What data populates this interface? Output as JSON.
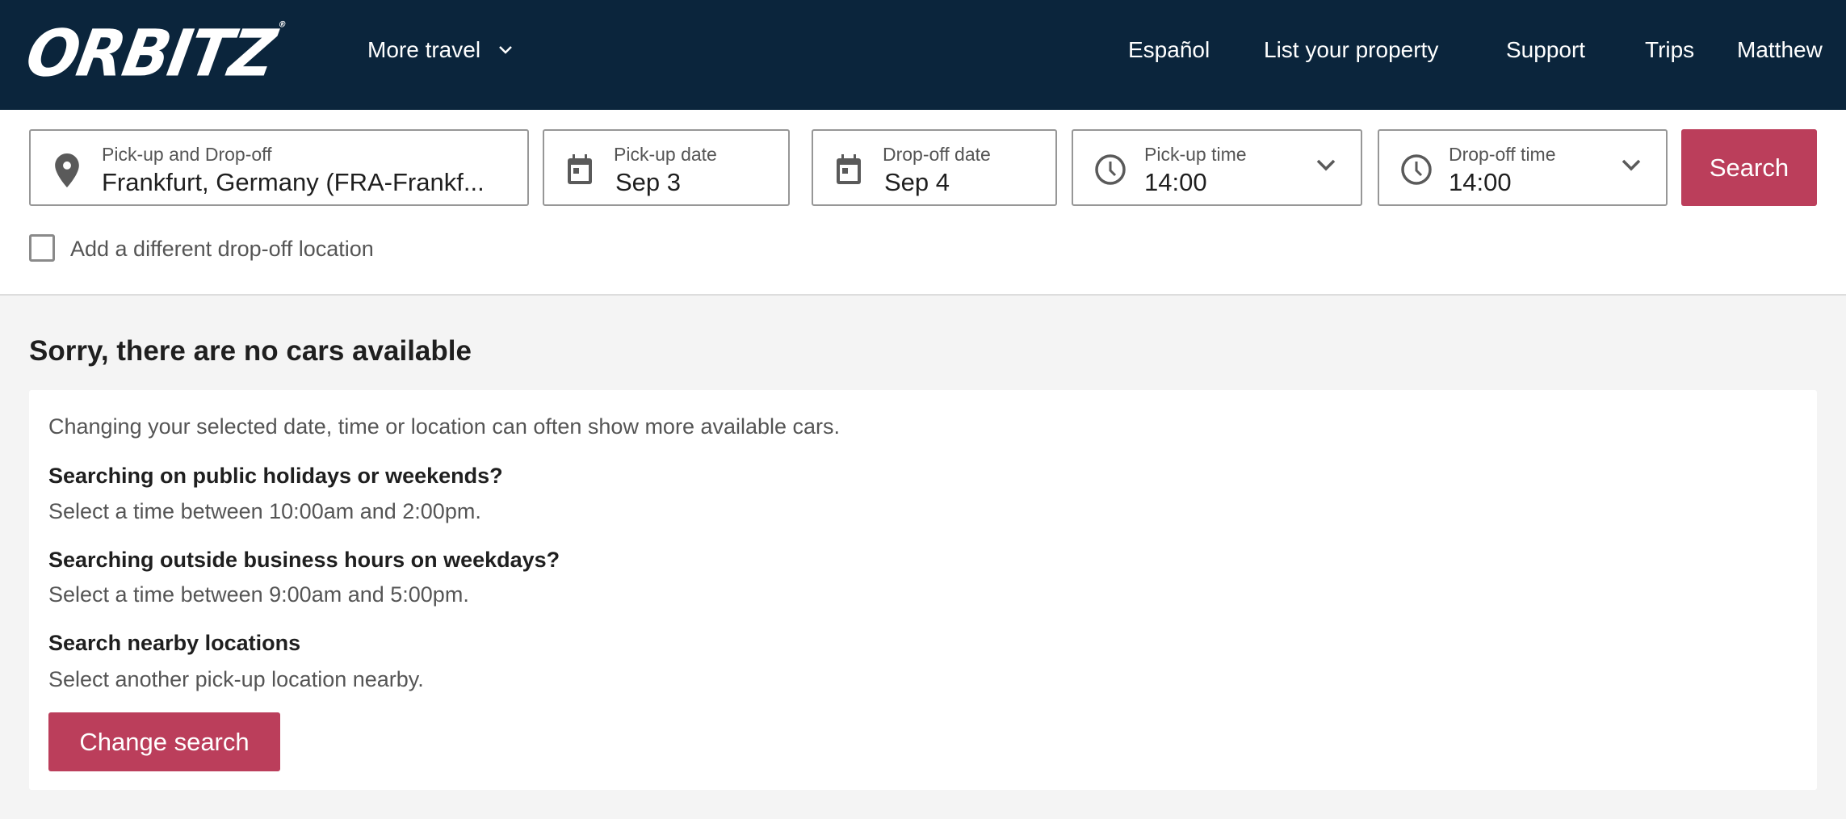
{
  "header": {
    "logo": "ORBITZ",
    "more_travel": "More travel",
    "nav": [
      "Español",
      "List your property",
      "Support",
      "Trips",
      "Matthew"
    ]
  },
  "search": {
    "location": {
      "label": "Pick-up and Drop-off",
      "value": "Frankfurt, Germany (FRA-Frankf..."
    },
    "pickup_date": {
      "label": "Pick-up date",
      "value": "Sep 3"
    },
    "dropoff_date": {
      "label": "Drop-off date",
      "value": "Sep 4"
    },
    "pickup_time": {
      "label": "Pick-up time",
      "value": "14:00"
    },
    "dropoff_time": {
      "label": "Drop-off time",
      "value": "14:00"
    },
    "search_label": "Search",
    "different_dropoff": {
      "label": "Add a different drop-off location",
      "checked": false
    }
  },
  "results": {
    "title": "Sorry, there are no cars available",
    "intro": "Changing your selected date, time or location can often show more available cars.",
    "tips": [
      {
        "heading": "Searching on public holidays or weekends?",
        "text": "Select a time between 10:00am and 2:00pm."
      },
      {
        "heading": "Searching outside business hours on weekdays?",
        "text": "Select a time between 9:00am and 5:00pm."
      },
      {
        "heading": "Search nearby locations",
        "text": "Select another pick-up location nearby."
      }
    ],
    "change_label": "Change search"
  },
  "colors": {
    "header_bg": "#0b253c",
    "accent": "#bb3e5b",
    "page_bg": "#f4f4f4"
  }
}
